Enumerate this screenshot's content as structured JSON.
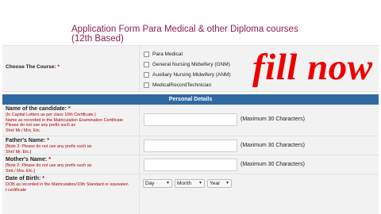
{
  "form": {
    "title": "Application Form Para Medical & other Diploma courses (12th Based)"
  },
  "course": {
    "label": "Choose The Course:",
    "required": "*",
    "options": [
      "Para Medical",
      "General Nursing Midwifery (GNM)",
      "Auxiliary Nursing Midwifery (ANM)",
      "MedicalRecordTechnician"
    ]
  },
  "overlay": {
    "text": "fill now",
    "color": "#ee0000"
  },
  "section": {
    "title": "Personal Details",
    "color": "#2f6aa3"
  },
  "fields": {
    "candidate": {
      "label": "Name of the candidate:",
      "required": "*",
      "note1": "(In Capital Letters as per class 10th Certificate.)",
      "note2": "Name as recorded in the Matriculation Examination Certificate",
      "note3": "Please do not use any prefix such as",
      "note4": "Shri/ Mr./ Mrs. Etc.",
      "max": "(Maximum 30 Characters)"
    },
    "father": {
      "label": "Father's Name:",
      "required": "*",
      "note1": "[Note 2: Please do not use any prefix such as",
      "note2": "Shri/ Mr. Etc.]",
      "max": "(Maximum 30 Characters)"
    },
    "mother": {
      "label": "Mother's Name:",
      "required": "*",
      "note1": "[Note 2: Please do not use any prefix such as",
      "note2": "Smt./ Mrs. Etc.]",
      "max": "(Maximum 30 Characters)"
    },
    "dob": {
      "label": "Date of Birth:",
      "required": "*",
      "note1": "DOB as recorded in the Matriculation/10th Standard or equivalen",
      "note2": "t certificate",
      "day": "Day",
      "month": "Month",
      "year": "Year"
    }
  }
}
